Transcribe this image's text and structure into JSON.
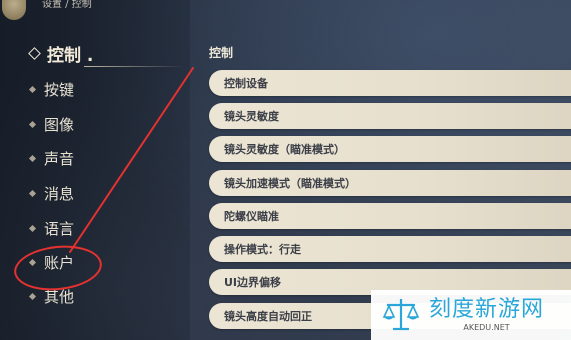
{
  "breadcrumb": "设置 / 控制",
  "sidebar": {
    "items": [
      {
        "label": "控制 ."
      },
      {
        "label": "按键"
      },
      {
        "label": "图像"
      },
      {
        "label": "声音"
      },
      {
        "label": "消息"
      },
      {
        "label": "语言"
      },
      {
        "label": "账户"
      },
      {
        "label": "其他"
      }
    ]
  },
  "main": {
    "section_title": "控制",
    "settings": [
      {
        "label": "控制设备"
      },
      {
        "label": "镜头灵敏度"
      },
      {
        "label": "镜头灵敏度（瞄准模式）"
      },
      {
        "label": "镜头加速模式（瞄准模式）"
      },
      {
        "label": "陀螺仪瞄准"
      },
      {
        "label": "操作模式：行走"
      },
      {
        "label": "UI边界偏移"
      },
      {
        "label": "镜头高度自动回正"
      }
    ]
  },
  "annotation": {
    "color": "#e3322f"
  },
  "watermark": {
    "title": "刻度新游网",
    "subtitle": "AKEDU.NET",
    "color": "#2aa7d8"
  }
}
